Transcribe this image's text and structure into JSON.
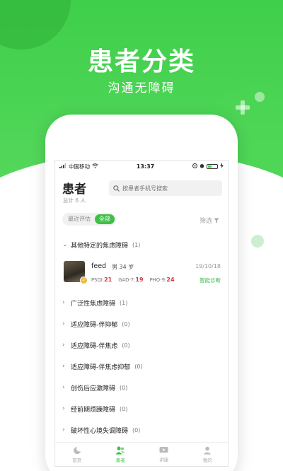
{
  "hero": {
    "title": "患者分类",
    "subtitle": "沟通无障碍"
  },
  "status_bar": {
    "carrier": "中国移动",
    "time": "13:37"
  },
  "header": {
    "title": "患者",
    "count": "总计 6 人",
    "search_placeholder": "按患者手机号搜索"
  },
  "filters": {
    "options": [
      "最近评估",
      "全部"
    ],
    "selected": "全部",
    "filter_label": "筛选"
  },
  "expanded_group": {
    "name": "其他特定的焦虑障碍",
    "count": "(1)",
    "patient": {
      "name": "feed",
      "info": "男 34 岁",
      "date": "19/10/18",
      "scores": [
        {
          "label": "PSQI:",
          "value": "21"
        },
        {
          "label": "GAD-7:",
          "value": "19"
        },
        {
          "label": "PHQ-9:",
          "value": "24"
        }
      ],
      "action": "智能诊断"
    }
  },
  "groups": [
    {
      "name": "广泛性焦虑障碍",
      "count": "(1)"
    },
    {
      "name": "适应障碍-伴抑郁",
      "count": "(0)"
    },
    {
      "name": "适应障碍-伴焦虑",
      "count": "(0)"
    },
    {
      "name": "适应障碍-伴焦虑抑郁",
      "count": "(0)"
    },
    {
      "name": "创伤后应激障碍",
      "count": "(0)"
    },
    {
      "name": "经前期烦躁障碍",
      "count": "(0)"
    },
    {
      "name": "破坏性心境失调障碍",
      "count": "(0)"
    }
  ],
  "tabbar": {
    "items": [
      {
        "label": "首页",
        "icon": "home-icon"
      },
      {
        "label": "患者",
        "icon": "patients-icon"
      },
      {
        "label": "讲座",
        "icon": "lecture-icon"
      },
      {
        "label": "我的",
        "icon": "profile-icon"
      }
    ],
    "active": "患者"
  },
  "colors": {
    "brand": "#3fcf4a",
    "accent": "#3fbf47",
    "score": "#d9363e"
  }
}
